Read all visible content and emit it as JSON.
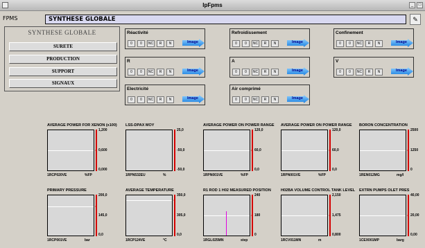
{
  "window": {
    "title": "IpFpms",
    "min": "_",
    "max": "□"
  },
  "header": {
    "app_label": "FPMS",
    "path": "SYNTHESE GLOBALE",
    "edit_icon": "pencil-icon"
  },
  "nav": {
    "title": "SYNTHESE GLOBALE",
    "items": [
      "SURETE",
      "PRODUCTION",
      "SUPPORT",
      "SIGNAUX"
    ]
  },
  "panels": [
    {
      "title": "Réactivité",
      "buttons": [
        "0",
        "0",
        "NC",
        "R",
        "N"
      ],
      "image_label": "Image"
    },
    {
      "title": "Refroidissement",
      "buttons": [
        "0",
        "0",
        "NC",
        "R",
        "N"
      ],
      "image_label": "Image"
    },
    {
      "title": "Confinement",
      "buttons": [
        "0",
        "0",
        "NC",
        "R",
        "N"
      ],
      "image_label": "Image"
    },
    {
      "title": "R",
      "buttons": [
        "0",
        "0",
        "NC",
        "R",
        "N"
      ],
      "image_label": "Image"
    },
    {
      "title": "A",
      "buttons": [
        "0",
        "0",
        "NC",
        "R",
        "N"
      ],
      "image_label": "Image"
    },
    {
      "title": "V",
      "buttons": [
        "0",
        "0",
        "NC",
        "R",
        "N"
      ],
      "image_label": "Image"
    },
    {
      "title": "Electricité",
      "buttons": [
        "0",
        "0",
        "NC",
        "R",
        "N"
      ],
      "image_label": "Image"
    },
    {
      "title": "Air comprimé",
      "buttons": [
        "0",
        "0",
        "NC",
        "R",
        "N"
      ],
      "image_label": "Image"
    }
  ],
  "gauges": [
    {
      "title": "AVERAGE POWER FOR XENON (x100)",
      "tick_top": "1,200",
      "tick_mid": "0,600",
      "tick_bot": "0,000",
      "tag": "1RCP020VE",
      "unit": "%FP",
      "level": 0.5
    },
    {
      "title": "LSS-DPAX MOY",
      "tick_top": "25,0",
      "tick_mid": "-50,0",
      "tick_bot": "-50,0",
      "tag": "1RPN532EU",
      "unit": "%",
      "level": null
    },
    {
      "title": "AVERAGE POWER ON POWER RANGE",
      "tick_top": "120,0",
      "tick_mid": "60,0",
      "tick_bot": "0,0",
      "tag": "1RPN001VE",
      "unit": "%FP",
      "level": 0.5
    },
    {
      "title": "AVERAGE POWER ON POWER RANGE",
      "tick_top": "120,0",
      "tick_mid": "60,0",
      "tick_bot": "0,0",
      "tag": "1RPN001VE",
      "unit": "%FP",
      "level": 0.5
    },
    {
      "title": "BORON CONCENTRATION",
      "tick_top": "2500",
      "tick_mid": "1250",
      "tick_bot": "0",
      "tag": "1REN012MG",
      "unit": "mg/l",
      "level": 0.5
    },
    {
      "title": "PRIMARY PRESSURE",
      "tick_top": "200,0",
      "tick_mid": "145,0",
      "tick_bot": "0,0",
      "tag": "1RCP001VE",
      "unit": "bar",
      "level": 0.72
    },
    {
      "title": "AVERAGE TEMPERATURE",
      "tick_top": "350,0",
      "tick_mid": "305,0",
      "tick_bot": "0,0",
      "tag": "1RCP124VE",
      "unit": "°C",
      "level": 0.87
    },
    {
      "title": "R1 ROD 1 H02 MEASURED POSITION",
      "tick_top": "240",
      "tick_mid": "180",
      "tick_bot": "0",
      "tag": "1RGL025MN",
      "unit": "step",
      "level": 0.5,
      "marker": 0.6
    },
    {
      "title": "H02BA VOLUME CONTROL TANK LEVEL",
      "tick_top": "2,150",
      "tick_mid": "1,475",
      "tick_bot": "0,800",
      "tag": "1RCV011MN",
      "unit": "m",
      "level": 0.5
    },
    {
      "title": "EXTRN PUMPS OLET PRES",
      "tick_top": "40,00",
      "tick_mid": "20,00",
      "tick_bot": "0,00",
      "tag": "1CEX001MP",
      "unit": "barg",
      "level": 0.5
    }
  ]
}
